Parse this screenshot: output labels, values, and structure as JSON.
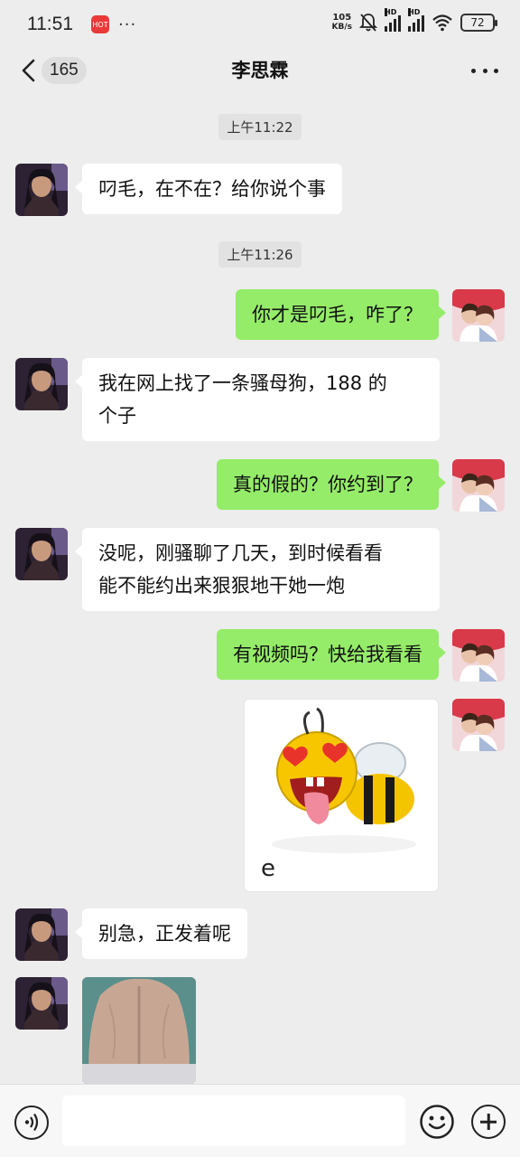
{
  "status_bar": {
    "time": "11:51",
    "app_badge": "HOT",
    "dots": "···",
    "network_speed_value": "105",
    "network_speed_unit": "KB/s",
    "signal_label_1": "HD",
    "signal_label_2": "HD",
    "battery": "72"
  },
  "nav": {
    "unread_count": "165",
    "title": "李思霖"
  },
  "messages": [
    {
      "type": "time",
      "text": "上午11:22"
    },
    {
      "type": "text",
      "side": "in",
      "text": "叼毛，在不在？给你说个事"
    },
    {
      "type": "time",
      "text": "上午11:26"
    },
    {
      "type": "text",
      "side": "out",
      "text": "你才是叼毛，咋了？"
    },
    {
      "type": "text",
      "side": "in",
      "text_line1": "我在网上找了一条骚母狗，188 的",
      "text_line2": "个子"
    },
    {
      "type": "text",
      "side": "out",
      "text": "真的假的？你约到了？"
    },
    {
      "type": "text",
      "side": "in",
      "text_line1": "没呢，刚骚聊了几天，到时候看看",
      "text_line2": "能不能约出来狠狠地干她一炮"
    },
    {
      "type": "text",
      "side": "out",
      "text": "有视频吗？快给我看看"
    },
    {
      "type": "sticker",
      "side": "out",
      "icon": "bee-sticker-icon",
      "caption": "e"
    },
    {
      "type": "text",
      "side": "in",
      "text": "别急，正发着呢"
    },
    {
      "type": "image",
      "side": "in",
      "icon": "back-photo-thumbnail"
    }
  ],
  "colors": {
    "background": "#ededed",
    "incoming_bubble": "#ffffff",
    "outgoing_bubble": "#95ec69",
    "input_bar": "#f7f7f7"
  },
  "input_bar": {
    "placeholder": ""
  }
}
